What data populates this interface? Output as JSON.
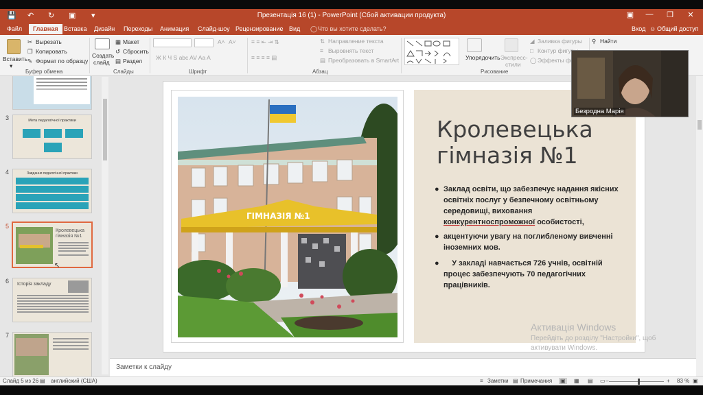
{
  "title_bar": {
    "title": "Презентація 16 (1) - PowerPoint (Сбой активации продукта)"
  },
  "tabs": [
    "Файл",
    "Главная",
    "Вставка",
    "Дизайн",
    "Переходы",
    "Анимация",
    "Слайд-шоу",
    "Рецензирование",
    "Вид"
  ],
  "active_tab": "Главная",
  "tell_me": "Что вы хотите сделать?",
  "account": {
    "signin": "Вход",
    "share": "Общий доступ"
  },
  "ribbon": {
    "paste": "Вставить",
    "cut": "Вырезать",
    "copy": "Копировать",
    "format_painter": "Формат по образцу",
    "clipboard_label": "Буфер обмена",
    "new_slide_1": "Создать",
    "new_slide_2": "слайд",
    "layout": "Макет",
    "reset": "Сбросить",
    "section": "Раздел",
    "slides_label": "Слайды",
    "font_label": "Шрифт",
    "font_letters": "Ж К Ч S abc AV Aa A",
    "text_direction": "Направление текста",
    "align_text": "Выровнять текст",
    "convert_smartart": "Преобразовать в SmartArt",
    "paragraph_label": "Абзац",
    "arrange": "Упорядочить",
    "quick_styles_1": "Экспресс-",
    "quick_styles_2": "стили",
    "shape_fill": "Заливка фигуры",
    "shape_outline": "Контур фигуры",
    "shape_effects": "Эффекты фигуры",
    "drawing_label": "Рисование",
    "find": "Найти"
  },
  "thumbnails": [
    {
      "num": "",
      "title": ""
    },
    {
      "num": "3",
      "title": "Мета педагогічної практики"
    },
    {
      "num": "4",
      "title": "Завдання педагогічної практики"
    },
    {
      "num": "5",
      "title": "Кролевецька гімназія №1"
    },
    {
      "num": "6",
      "title": "Історія закладу"
    },
    {
      "num": "7",
      "title": ""
    }
  ],
  "slide": {
    "title": "Кролевецька гімназія №1",
    "school_sign": "ГІМНАЗІЯ №1",
    "bullets": [
      {
        "pre": "Заклад освіти, що забезпечує надання якісних освітніх послуг у безпечному освітньому середовищі, виховання ",
        "underlined": "конкурентноспроможної",
        "post": " особистості,"
      },
      {
        "pre": "акцентуючи  увагу на поглибленому вивченні іноземних мов.",
        "underlined": "",
        "post": ""
      },
      {
        "pre": "    У закладі навчається 726 учнів, освітній процес забезпечують 70 педагогічних працівників.",
        "underlined": "",
        "post": ""
      }
    ]
  },
  "activation": {
    "title": "Активація Windows",
    "line1": "Перейдіть до розділу \"Настройки\", щоб",
    "line2": "активувати Windows."
  },
  "webcam": {
    "name": "Безродна Марія"
  },
  "notes_placeholder": "Заметки к слайду",
  "status": {
    "slide_of": "Слайд 5 из 26",
    "language": "английский (США)",
    "notes": "Заметки",
    "comments": "Примечания",
    "zoom": "83 %"
  },
  "colors": {
    "accent": "#b7472a",
    "slide_panel": "#ebe3d5",
    "selected_thumb": "#e0683f"
  }
}
